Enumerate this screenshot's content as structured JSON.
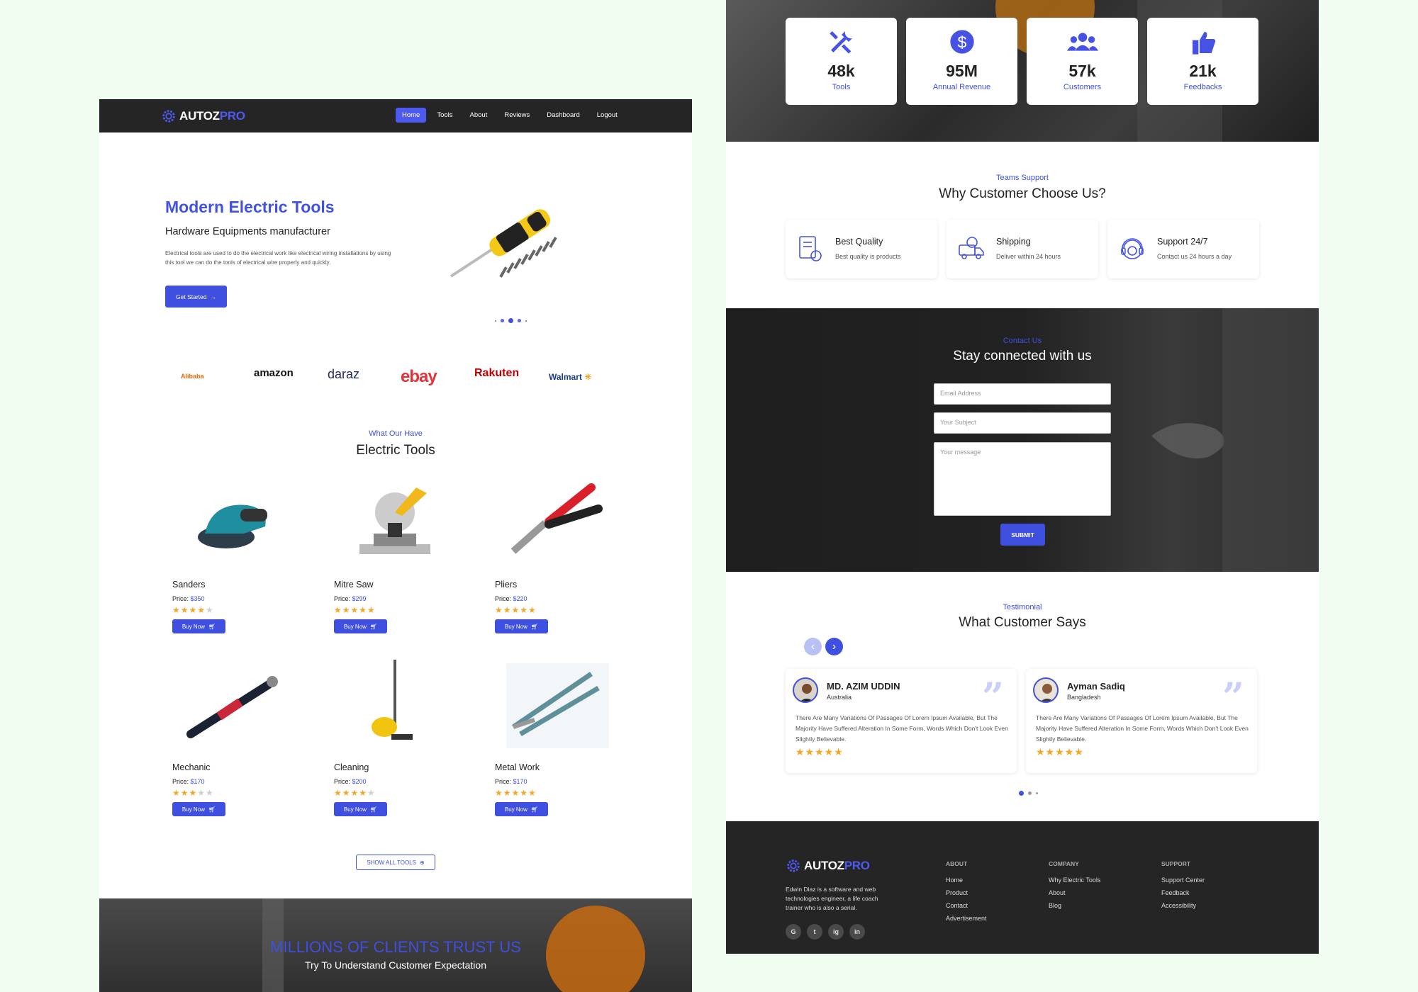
{
  "brand": {
    "name_a": "AUTOZ",
    "name_b": "PRO"
  },
  "nav": {
    "items": [
      "Home",
      "Tools",
      "About",
      "Reviews",
      "Dashboard",
      "Logout"
    ]
  },
  "hero": {
    "title": "Modern Electric Tools",
    "subtitle": "Hardware Equipments manufacturer",
    "description": "Electrical tools are used to do the electrical work like electrical wiring installations by using this tool we can do the tools of electrical wire properly and quickly.",
    "cta": "Get Started"
  },
  "partners": [
    "Alibaba",
    "amazon",
    "daraz",
    "ebay",
    "Rakuten",
    "Walmart"
  ],
  "tools_section": {
    "kicker": "What Our Have",
    "title": "Electric Tools",
    "price_label": "Price:",
    "buy_label": "Buy Now",
    "show_all": "SHOW ALL TOOLS",
    "products": [
      {
        "name": "Sanders",
        "price": "$350",
        "rating": 4
      },
      {
        "name": "Mitre Saw",
        "price": "$299",
        "rating": 5
      },
      {
        "name": "Pliers",
        "price": "$220",
        "rating": 5
      },
      {
        "name": "Mechanic",
        "price": "$170",
        "rating": 3
      },
      {
        "name": "Cleaning",
        "price": "$200",
        "rating": 4
      },
      {
        "name": "Metal Work",
        "price": "$170",
        "rating": 5
      }
    ]
  },
  "trust": {
    "title": "MILLIONS OF CLIENTS TRUST US",
    "subtitle": "Try To Understand Customer Expectation"
  },
  "stats": [
    {
      "value": "48k",
      "label": "Tools",
      "icon": "tools-icon"
    },
    {
      "value": "95M",
      "label": "Annual Revenue",
      "icon": "dollar-icon"
    },
    {
      "value": "57k",
      "label": "Customers",
      "icon": "users-icon"
    },
    {
      "value": "21k",
      "label": "Feedbacks",
      "icon": "thumbs-up-icon"
    }
  ],
  "why": {
    "kicker": "Teams Support",
    "title": "Why Customer Choose Us?",
    "features": [
      {
        "title": "Best Quality",
        "desc": "Best quality is products",
        "icon": "quality-icon"
      },
      {
        "title": "Shipping",
        "desc": "Deliver within 24 hours",
        "icon": "truck-icon"
      },
      {
        "title": "Support 24/7",
        "desc": "Contact us 24 hours a day",
        "icon": "support-icon"
      }
    ]
  },
  "contact": {
    "kicker": "Contact Us",
    "title": "Stay connected with us",
    "email_ph": "Email Address",
    "subject_ph": "Your Subject",
    "message_ph": "Your message",
    "submit": "SUBMIT"
  },
  "testimonials": {
    "kicker": "Testimonial",
    "title": "What Customer Says",
    "items": [
      {
        "name": "MD. AZIM UDDIN",
        "country": "Australia",
        "text": "There Are Many Variations Of Passages Of Lorem Ipsum Available, But The Majority Have Suffered Alteration In Some Form, Words Which Don't Look Even Slightly Believable.",
        "rating": 5
      },
      {
        "name": "Ayman Sadiq",
        "country": "Bangladesh",
        "text": "There Are Many Variations Of Passages Of Lorem Ipsum Available, But The Majority Have Suffered Alteration In Some Form, Words Which Don't Look Even Slightly Believable.",
        "rating": 5
      }
    ]
  },
  "footer": {
    "about_text": "Edwin Diaz is a software and web technologies engineer, a life coach trainer who is also a serial.",
    "cols": [
      {
        "heading": "ABOUT",
        "links": [
          "Home",
          "Product",
          "Contact",
          "Advertisement"
        ]
      },
      {
        "heading": "COMPANY",
        "links": [
          "Why Electric Tools",
          "About",
          "Blog"
        ]
      },
      {
        "heading": "SUPPORT",
        "links": [
          "Support Center",
          "Feedback",
          "Accessibility"
        ]
      }
    ],
    "social": [
      "G",
      "t",
      "ig",
      "in"
    ]
  },
  "colors": {
    "accent": "#3f4fe0",
    "dark": "#252525",
    "star": "#f5a623",
    "page_bg": "#f1fdf0"
  }
}
